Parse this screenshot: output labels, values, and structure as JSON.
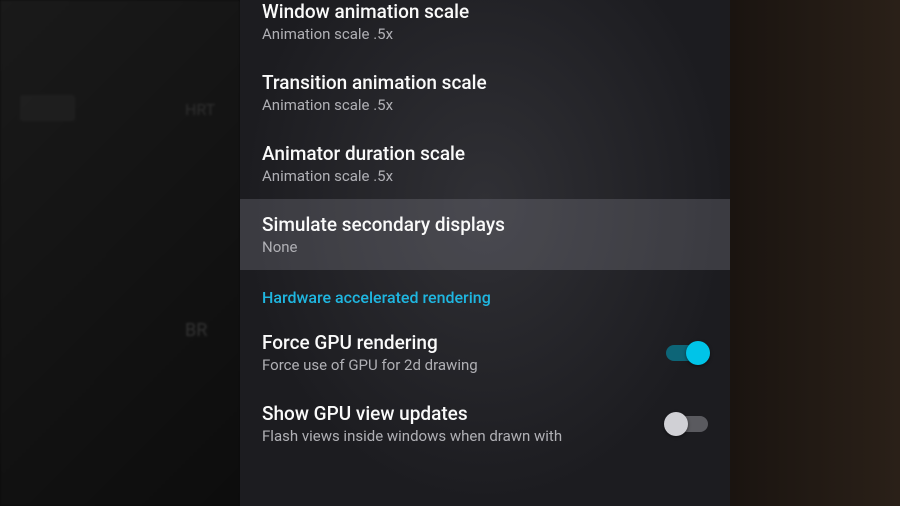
{
  "background": {
    "hrt_label": "HRT",
    "br_label": "BR"
  },
  "settings": {
    "items": [
      {
        "title": "Window animation scale",
        "subtitle": "Animation scale .5x"
      },
      {
        "title": "Transition animation scale",
        "subtitle": "Animation scale .5x"
      },
      {
        "title": "Animator duration scale",
        "subtitle": "Animation scale .5x"
      },
      {
        "title": "Simulate secondary displays",
        "subtitle": "None"
      }
    ],
    "section_header": "Hardware accelerated rendering",
    "toggle_items": [
      {
        "title": "Force GPU rendering",
        "subtitle": "Force use of GPU for 2d drawing"
      },
      {
        "title": "Show GPU view updates",
        "subtitle": "Flash views inside windows when drawn with"
      }
    ]
  }
}
